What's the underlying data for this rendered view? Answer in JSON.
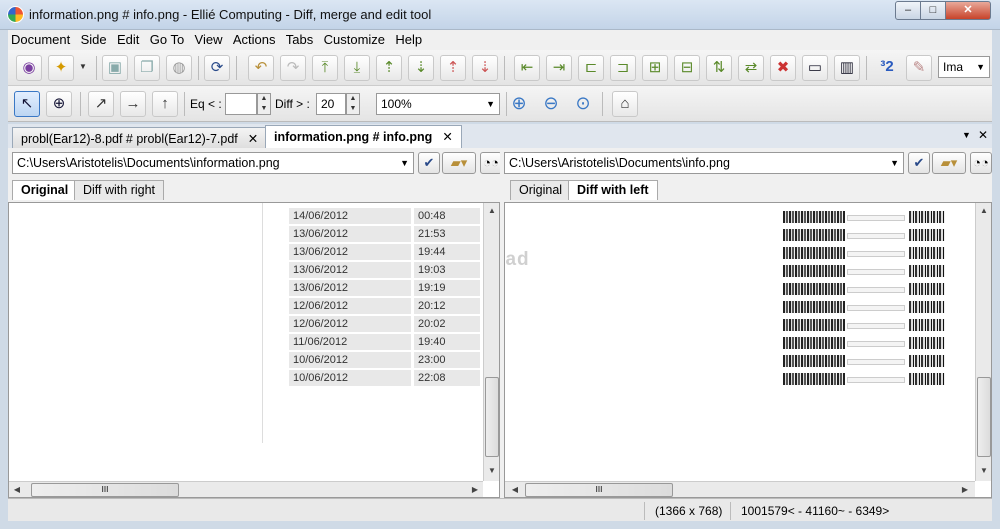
{
  "window": {
    "title": "information.png # info.png - Ellié Computing - Diff, merge and edit tool",
    "min": "–",
    "max": "□",
    "close": "✕"
  },
  "menu": [
    "Document",
    "Side",
    "Edit",
    "Go To",
    "View",
    "Actions",
    "Tabs",
    "Customize",
    "Help"
  ],
  "toolbar2": {
    "eq_label": "Eq < :",
    "eq_value": "",
    "diff_label": "Diff > :",
    "diff_value": "20",
    "zoom_value": "100%",
    "image_mode": "Ima"
  },
  "tabs": [
    {
      "label": "probl(Ear12)-8.pdf # probl(Ear12)-7.pdf",
      "close": "✕"
    },
    {
      "label": "information.png # info.png",
      "close": "✕"
    }
  ],
  "tabstrip_controls": {
    "menu": "▼",
    "close": "✕"
  },
  "left_pane": {
    "path": "C:\\Users\\Aristotelis\\Documents\\information.png",
    "tabs": [
      "Original",
      "Diff with right"
    ],
    "rows": [
      {
        "date": "14/06/2012",
        "time": "00:48"
      },
      {
        "date": "13/06/2012",
        "time": "21:53"
      },
      {
        "date": "13/06/2012",
        "time": "19:44"
      },
      {
        "date": "13/06/2012",
        "time": "19:03"
      },
      {
        "date": "13/06/2012",
        "time": "19:19"
      },
      {
        "date": "12/06/2012",
        "time": "20:12"
      },
      {
        "date": "12/06/2012",
        "time": "20:02"
      },
      {
        "date": "11/06/2012",
        "time": "19:40"
      },
      {
        "date": "10/06/2012",
        "time": "23:00"
      },
      {
        "date": "10/06/2012",
        "time": "22:08"
      }
    ],
    "hscroll_grip": "III"
  },
  "right_pane": {
    "path": "C:\\Users\\Aristotelis\\Documents\\info.png",
    "tabs": [
      "Original",
      "Diff with left"
    ],
    "watermark": "download",
    "hscroll_grip": "III"
  },
  "status": {
    "dimensions": "(1366 x 768)",
    "diff_info": "1001579< - 41160~ - 6349>"
  },
  "colors": {
    "accent": "#3a78c5",
    "close": "#c7432a"
  }
}
